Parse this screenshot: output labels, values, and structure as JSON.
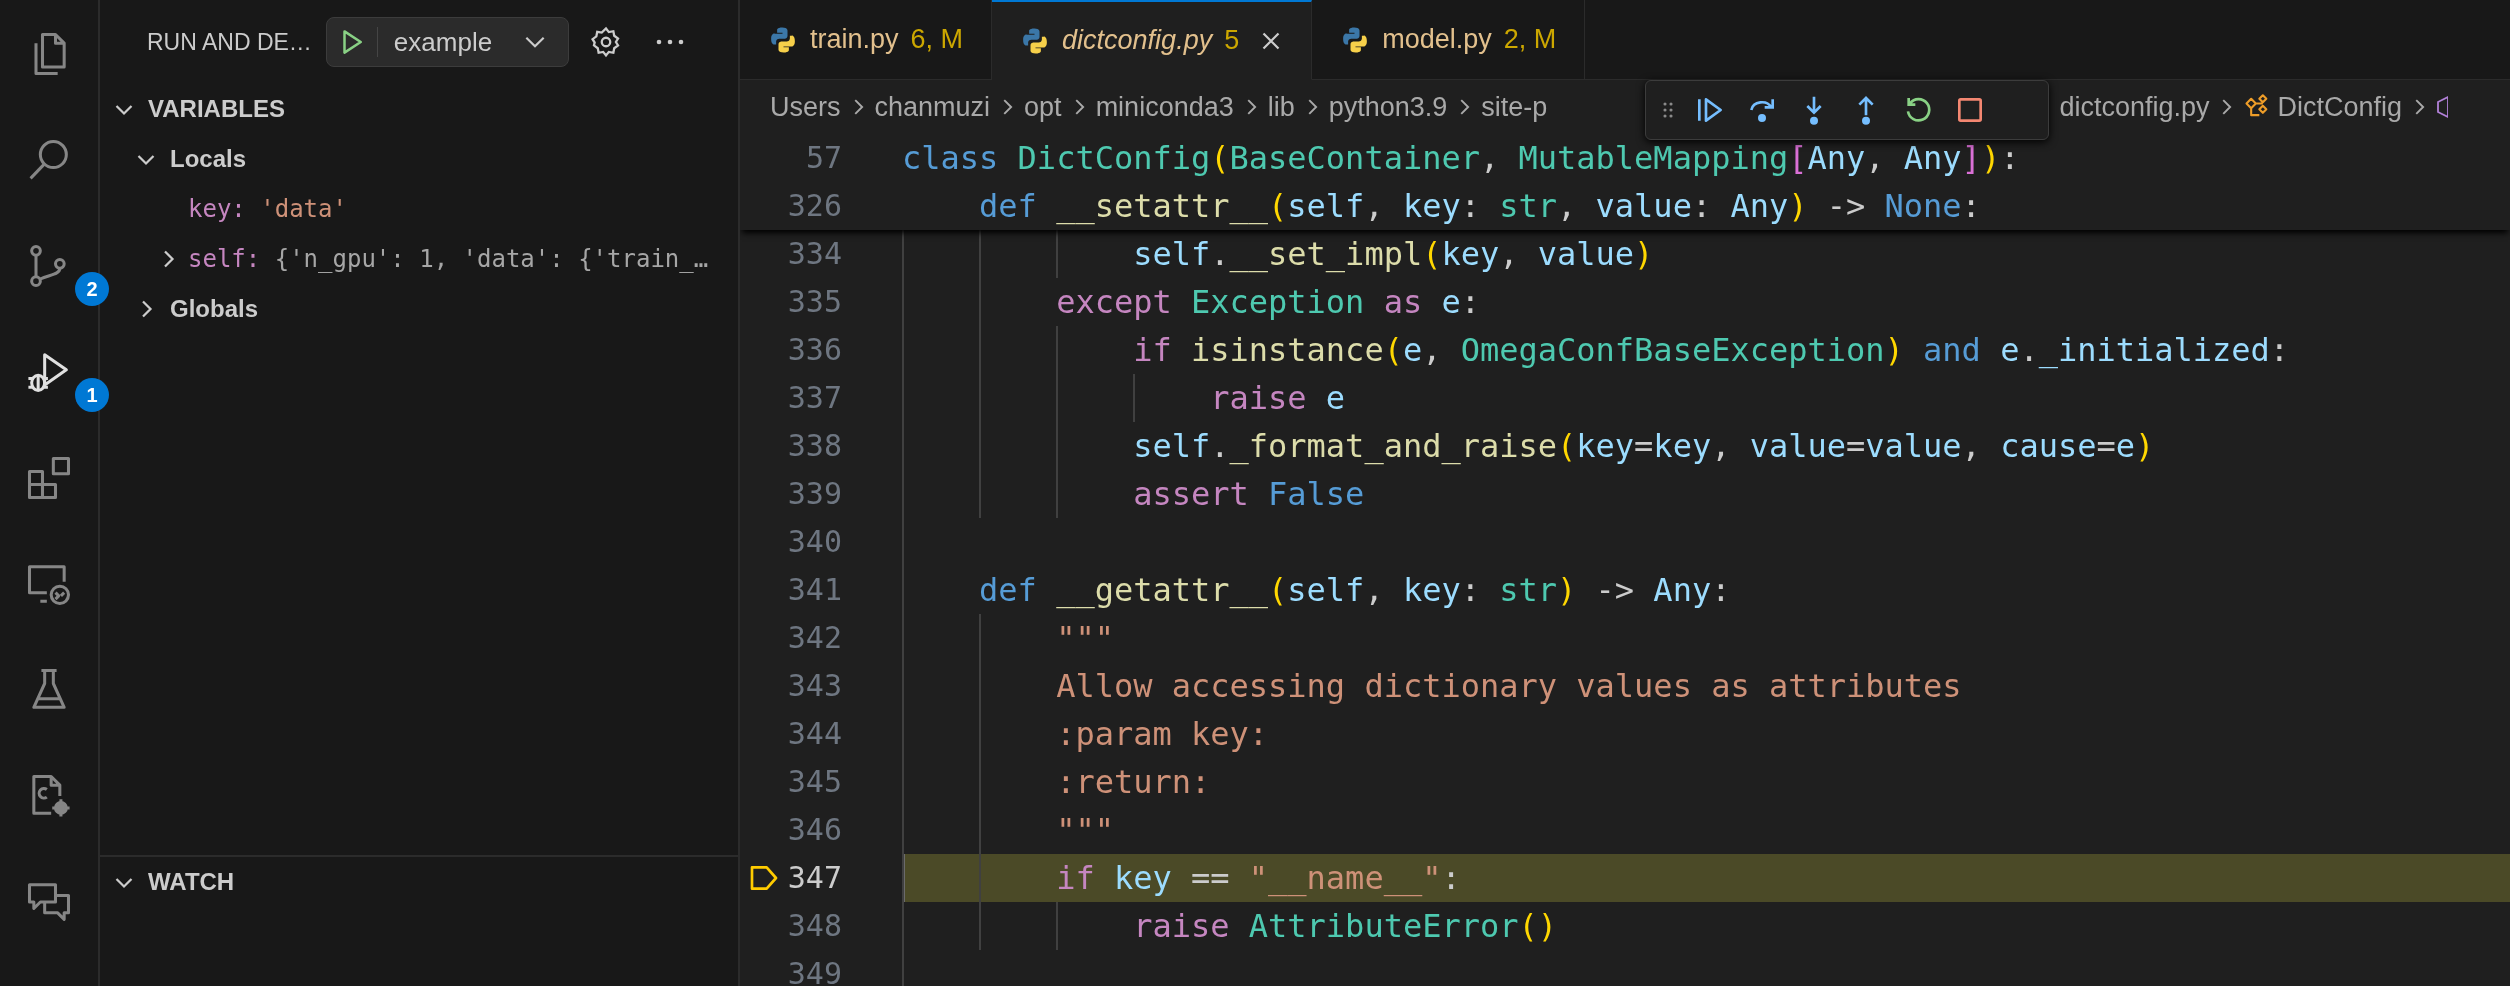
{
  "activity_bar": [
    {
      "kind": "explorer",
      "selected": false
    },
    {
      "kind": "search",
      "selected": false
    },
    {
      "kind": "source-control",
      "selected": false,
      "badge": "2"
    },
    {
      "kind": "run-debug",
      "selected": true,
      "badge": "1"
    },
    {
      "kind": "extensions",
      "selected": false
    },
    {
      "kind": "remote",
      "selected": false
    },
    {
      "kind": "testing",
      "selected": false
    },
    {
      "kind": "cpp-config",
      "selected": false
    },
    {
      "kind": "chat",
      "selected": false
    }
  ],
  "sidebar": {
    "title": "RUN AND DE…",
    "launch_config": "example",
    "variables": {
      "title": "VARIABLES",
      "expanded": true,
      "scopes": [
        {
          "name": "Locals",
          "expanded": true,
          "children": [
            {
              "name": "key:",
              "value": "'data'",
              "kind": "string"
            },
            {
              "name": "self:",
              "value": "{'n_gpu': 1, 'data': {'train_…",
              "kind": "object",
              "expanded": false
            }
          ]
        },
        {
          "name": "Globals",
          "expanded": false
        }
      ]
    },
    "watch": {
      "title": "WATCH",
      "expanded": true
    }
  },
  "tabs": [
    {
      "label": "train.py",
      "status": "6, M",
      "selected": false,
      "preview": false
    },
    {
      "label": "dictconfig.py",
      "status": "5",
      "selected": true,
      "preview": true
    },
    {
      "label": "model.py",
      "status": "2, M",
      "selected": false,
      "preview": false
    }
  ],
  "breadcrumb": [
    {
      "label": "Users",
      "kind": "folder"
    },
    {
      "label": "chanmuzi",
      "kind": "folder"
    },
    {
      "label": "opt",
      "kind": "folder"
    },
    {
      "label": "miniconda3",
      "kind": "folder"
    },
    {
      "label": "lib",
      "kind": "folder"
    },
    {
      "label": "python3.9",
      "kind": "folder"
    },
    {
      "label": "site-p",
      "kind": "folder"
    },
    {
      "label": "dictconfig.py",
      "kind": "file"
    },
    {
      "label": "DictConfig",
      "kind": "class"
    }
  ],
  "editor": {
    "sticky_lines": [
      {
        "number": "57",
        "tokens": [
          {
            "text": "class",
            "kind": "keyword"
          },
          {
            "text": " DictConfig",
            "kind": "type"
          },
          {
            "text": "(",
            "kind": "bracket"
          },
          {
            "text": "BaseContainer",
            "kind": "type"
          },
          {
            "text": ",",
            "kind": "punct"
          },
          {
            "text": " MutableMapping",
            "kind": "type"
          },
          {
            "text": "[",
            "kind": "bracket2"
          },
          {
            "text": "Any",
            "kind": "variable"
          },
          {
            "text": ",",
            "kind": "punct"
          },
          {
            "text": " Any",
            "kind": "variable"
          },
          {
            "text": "]",
            "kind": "bracket2"
          },
          {
            "text": ")",
            "kind": "bracket"
          },
          {
            "text": ":",
            "kind": "punct"
          }
        ]
      },
      {
        "number": "326",
        "tokens": [
          {
            "text": "    def",
            "kind": "keyword"
          },
          {
            "text": " __setattr__",
            "kind": "function"
          },
          {
            "text": "(",
            "kind": "bracket"
          },
          {
            "text": "self",
            "kind": "variable"
          },
          {
            "text": ",",
            "kind": "punct"
          },
          {
            "text": " key",
            "kind": "variable"
          },
          {
            "text": ":",
            "kind": "punct"
          },
          {
            "text": " str",
            "kind": "type"
          },
          {
            "text": ",",
            "kind": "punct"
          },
          {
            "text": " value",
            "kind": "variable"
          },
          {
            "text": ":",
            "kind": "punct"
          },
          {
            "text": " Any",
            "kind": "variable"
          },
          {
            "text": ")",
            "kind": "bracket"
          },
          {
            "text": " ->",
            "kind": "punct"
          },
          {
            "text": " None",
            "kind": "keyword"
          },
          {
            "text": ":",
            "kind": "punct"
          }
        ]
      }
    ],
    "lines": [
      {
        "number": "334",
        "current": false,
        "tokens": [
          {
            "text": "            self",
            "kind": "variable"
          },
          {
            "text": ".",
            "kind": "punct"
          },
          {
            "text": "__set_impl",
            "kind": "function"
          },
          {
            "text": "(",
            "kind": "bracket"
          },
          {
            "text": "key",
            "kind": "variable"
          },
          {
            "text": ",",
            "kind": "punct"
          },
          {
            "text": " value",
            "kind": "variable"
          },
          {
            "text": ")",
            "kind": "bracket"
          }
        ]
      },
      {
        "number": "335",
        "current": false,
        "tokens": [
          {
            "text": "        except",
            "kind": "control"
          },
          {
            "text": " Exception",
            "kind": "type"
          },
          {
            "text": " as",
            "kind": "control"
          },
          {
            "text": " e",
            "kind": "variable"
          },
          {
            "text": ":",
            "kind": "punct"
          }
        ]
      },
      {
        "number": "336",
        "current": false,
        "tokens": [
          {
            "text": "            if",
            "kind": "control"
          },
          {
            "text": " isinstance",
            "kind": "function"
          },
          {
            "text": "(",
            "kind": "bracket"
          },
          {
            "text": "e",
            "kind": "variable"
          },
          {
            "text": ",",
            "kind": "punct"
          },
          {
            "text": " OmegaConfBaseException",
            "kind": "type"
          },
          {
            "text": ")",
            "kind": "bracket"
          },
          {
            "text": " and",
            "kind": "keyword"
          },
          {
            "text": " e",
            "kind": "variable"
          },
          {
            "text": ".",
            "kind": "punct"
          },
          {
            "text": "_initialized",
            "kind": "variable"
          },
          {
            "text": ":",
            "kind": "punct"
          }
        ]
      },
      {
        "number": "337",
        "current": false,
        "tokens": [
          {
            "text": "                raise",
            "kind": "control"
          },
          {
            "text": " e",
            "kind": "variable"
          }
        ]
      },
      {
        "number": "338",
        "current": false,
        "tokens": [
          {
            "text": "            self",
            "kind": "variable"
          },
          {
            "text": ".",
            "kind": "punct"
          },
          {
            "text": "_format_and_raise",
            "kind": "function"
          },
          {
            "text": "(",
            "kind": "bracket"
          },
          {
            "text": "key",
            "kind": "variable"
          },
          {
            "text": "=",
            "kind": "punct"
          },
          {
            "text": "key",
            "kind": "variable"
          },
          {
            "text": ",",
            "kind": "punct"
          },
          {
            "text": " value",
            "kind": "variable"
          },
          {
            "text": "=",
            "kind": "punct"
          },
          {
            "text": "value",
            "kind": "variable"
          },
          {
            "text": ",",
            "kind": "punct"
          },
          {
            "text": " cause",
            "kind": "variable"
          },
          {
            "text": "=",
            "kind": "punct"
          },
          {
            "text": "e",
            "kind": "variable"
          },
          {
            "text": ")",
            "kind": "bracket"
          }
        ]
      },
      {
        "number": "339",
        "current": false,
        "tokens": [
          {
            "text": "            assert",
            "kind": "control"
          },
          {
            "text": " False",
            "kind": "keyword"
          }
        ]
      },
      {
        "number": "340",
        "current": false
      },
      {
        "number": "341",
        "current": false,
        "tokens": [
          {
            "text": "    def",
            "kind": "keyword"
          },
          {
            "text": " __getattr__",
            "kind": "function"
          },
          {
            "text": "(",
            "kind": "bracket"
          },
          {
            "text": "self",
            "kind": "variable"
          },
          {
            "text": ",",
            "kind": "punct"
          },
          {
            "text": " key",
            "kind": "variable"
          },
          {
            "text": ":",
            "kind": "punct"
          },
          {
            "text": " str",
            "kind": "type"
          },
          {
            "text": ")",
            "kind": "bracket"
          },
          {
            "text": " ->",
            "kind": "punct"
          },
          {
            "text": " Any",
            "kind": "variable"
          },
          {
            "text": ":",
            "kind": "punct"
          }
        ]
      },
      {
        "number": "342",
        "current": false,
        "tokens": [
          {
            "text": "        \"\"\"",
            "kind": "string"
          }
        ]
      },
      {
        "number": "343",
        "current": false,
        "tokens": [
          {
            "text": "        Allow accessing dictionary values as attributes",
            "kind": "string"
          }
        ]
      },
      {
        "number": "344",
        "current": false,
        "tokens": [
          {
            "text": "        :param key:",
            "kind": "string"
          }
        ]
      },
      {
        "number": "345",
        "current": false,
        "tokens": [
          {
            "text": "        :return:",
            "kind": "string"
          }
        ]
      },
      {
        "number": "346",
        "current": false,
        "tokens": [
          {
            "text": "        \"\"\"",
            "kind": "string"
          }
        ]
      },
      {
        "number": "347",
        "current": true,
        "tokens": [
          {
            "text": "        if",
            "kind": "control"
          },
          {
            "text": " key",
            "kind": "variable"
          },
          {
            "text": " ==",
            "kind": "punct"
          },
          {
            "text": " \"__name__\"",
            "kind": "string"
          },
          {
            "text": ":",
            "kind": "punct"
          }
        ]
      },
      {
        "number": "348",
        "current": false,
        "tokens": [
          {
            "text": "            raise",
            "kind": "control"
          },
          {
            "text": " AttributeError",
            "kind": "type"
          },
          {
            "text": "()",
            "kind": "bracket"
          }
        ]
      },
      {
        "number": "349",
        "current": false
      }
    ]
  }
}
